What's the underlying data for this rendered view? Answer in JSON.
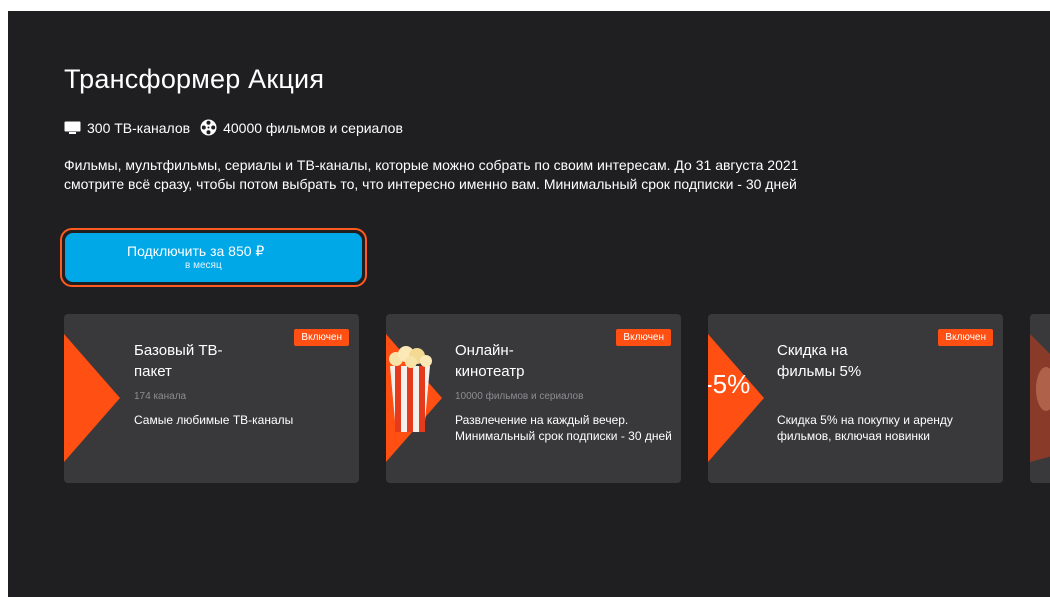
{
  "page": {
    "title": "Трансформер Акция",
    "features": [
      {
        "icon": "tv-icon",
        "text": "300 ТВ-каналов"
      },
      {
        "icon": "film-reel-icon",
        "text": "40000 фильмов и сериалов"
      }
    ],
    "description": "Фильмы, мультфильмы, сериалы и ТВ-каналы, которые можно собрать по своим интересам. До 31 августа 2021 смотрите всё сразу, чтобы потом выбрать то, что интересно именно вам. Минимальный срок подписки - 30 дней",
    "subscribe_button": {
      "label": "Подключить за 850 ₽",
      "sublabel": "в месяц"
    }
  },
  "cards": [
    {
      "badge": "Включен",
      "title": "Базовый ТВ-пакет",
      "subtitle": "174 канала",
      "text": "Самые любимые ТВ-каналы",
      "image": "orange-triangle"
    },
    {
      "badge": "Включен",
      "title": "Онлайн-кинотеатр",
      "subtitle": "10000 фильмов и сериалов",
      "text": "Развлечение на каждый вечер. Минимальный срок подписки - 30 дней",
      "image": "popcorn-image"
    },
    {
      "badge": "Включен",
      "title": "Скидка на фильмы 5%",
      "subtitle": "",
      "text": "Скидка 5% на покупку и аренду фильмов, включая новинки",
      "image": "discount-triangle",
      "image_text": "-5%"
    }
  ],
  "colors": {
    "background": "#1f1f21",
    "card": "#39393c",
    "accent": "#ff4f12",
    "button": "#00a8e8",
    "focus_ring": "#ff5a1f"
  }
}
